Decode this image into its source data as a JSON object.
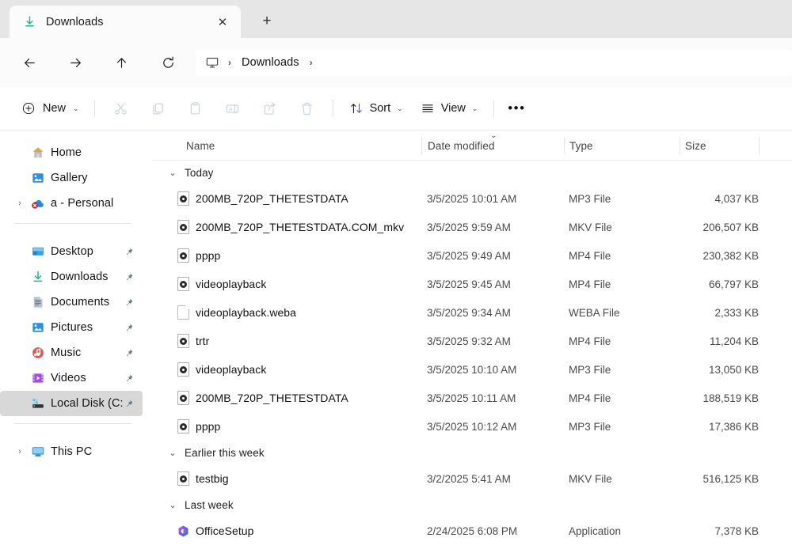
{
  "window": {
    "tab": {
      "title": "Downloads",
      "icon": "download-icon",
      "close_label": "✕"
    },
    "new_tab_label": "+"
  },
  "nav": {
    "back": "←",
    "forward": "→",
    "up": "↑",
    "refresh": "↻",
    "breadcrumb": {
      "root_icon": "this-pc-icon",
      "sep1": "›",
      "path": "Downloads",
      "sep2": "›"
    }
  },
  "toolbar": {
    "new_label": "New",
    "new_chevron": "⌄",
    "cut_label": "Cut",
    "copy_label": "Copy",
    "paste_label": "Paste",
    "rename_label": "Rename",
    "share_label": "Share",
    "delete_label": "Delete",
    "sort_label": "Sort",
    "sort_chevron": "⌄",
    "view_label": "View",
    "view_chevron": "⌄",
    "more_label": "•••"
  },
  "sidebar": {
    "items": [
      {
        "label": "Home",
        "icon": "home-icon",
        "pinned": false,
        "expandable": false,
        "selected": false
      },
      {
        "label": "Gallery",
        "icon": "gallery-icon",
        "pinned": false,
        "expandable": false,
        "selected": false
      },
      {
        "label": "a - Personal",
        "icon": "onedrive-error-icon",
        "pinned": false,
        "expandable": true,
        "selected": false
      },
      {
        "label": "Desktop",
        "icon": "desktop-icon",
        "pinned": true,
        "expandable": false,
        "selected": false
      },
      {
        "label": "Downloads",
        "icon": "download-icon",
        "pinned": true,
        "expandable": false,
        "selected": false
      },
      {
        "label": "Documents",
        "icon": "documents-icon",
        "pinned": true,
        "expandable": false,
        "selected": false
      },
      {
        "label": "Pictures",
        "icon": "pictures-icon",
        "pinned": true,
        "expandable": false,
        "selected": false
      },
      {
        "label": "Music",
        "icon": "music-icon",
        "pinned": true,
        "expandable": false,
        "selected": false
      },
      {
        "label": "Videos",
        "icon": "videos-icon",
        "pinned": true,
        "expandable": false,
        "selected": false
      },
      {
        "label": "Local Disk (C:",
        "icon": "disk-icon",
        "pinned": true,
        "expandable": false,
        "selected": true
      },
      {
        "label": "This PC",
        "icon": "this-pc-icon",
        "pinned": false,
        "expandable": true,
        "selected": false
      }
    ],
    "chevron_collapsed": "›",
    "pin_glyph": "📌"
  },
  "columns": {
    "name": "Name",
    "date_modified": "Date modified",
    "type": "Type",
    "size": "Size",
    "sort_indicator": "⌄",
    "sort_column": "date_modified"
  },
  "groups": [
    {
      "label": "Today",
      "chevron": "⌄",
      "rows": [
        {
          "name": "200MB_720P_THETESTDATA",
          "date": "3/5/2025 10:01 AM",
          "type": "MP3 File",
          "size": "4,037 KB",
          "icon": "media-file-icon"
        },
        {
          "name": "200MB_720P_THETESTDATA.COM_mkv",
          "date": "3/5/2025 9:59 AM",
          "type": "MKV File",
          "size": "206,507 KB",
          "icon": "media-file-icon"
        },
        {
          "name": "pppp",
          "date": "3/5/2025 9:49 AM",
          "type": "MP4 File",
          "size": "230,382 KB",
          "icon": "media-file-icon"
        },
        {
          "name": "videoplayback",
          "date": "3/5/2025 9:45 AM",
          "type": "MP4 File",
          "size": "66,797 KB",
          "icon": "media-file-icon"
        },
        {
          "name": "videoplayback.weba",
          "date": "3/5/2025 9:34 AM",
          "type": "WEBA File",
          "size": "2,333 KB",
          "icon": "generic-file-icon"
        },
        {
          "name": "trtr",
          "date": "3/5/2025 9:32 AM",
          "type": "MP4 File",
          "size": "11,204 KB",
          "icon": "media-file-icon"
        },
        {
          "name": "videoplayback",
          "date": "3/5/2025 10:10 AM",
          "type": "MP3 File",
          "size": "13,050 KB",
          "icon": "media-file-icon"
        },
        {
          "name": "200MB_720P_THETESTDATA",
          "date": "3/5/2025 10:11 AM",
          "type": "MP4 File",
          "size": "188,519 KB",
          "icon": "media-file-icon"
        },
        {
          "name": "pppp",
          "date": "3/5/2025 10:12 AM",
          "type": "MP3 File",
          "size": "17,386 KB",
          "icon": "media-file-icon"
        }
      ]
    },
    {
      "label": "Earlier this week",
      "chevron": "⌄",
      "rows": [
        {
          "name": "testbig",
          "date": "3/2/2025 5:41 AM",
          "type": "MKV File",
          "size": "516,125 KB",
          "icon": "media-file-icon"
        }
      ]
    },
    {
      "label": "Last week",
      "chevron": "⌄",
      "rows": [
        {
          "name": "OfficeSetup",
          "date": "2/24/2025 6:08 PM",
          "type": "Application",
          "size": "7,378 KB",
          "icon": "office-app-icon"
        }
      ]
    }
  ],
  "colors": {
    "tabbar_bg": "#e6e6e6",
    "toolbar_bg": "#ffffff",
    "accent_download": "#2fae8e",
    "selected_row": "#d8d8d8",
    "disabled_icon": "#c6d3de",
    "text_primary": "#121212",
    "text_secondary": "#4a4a4a"
  }
}
